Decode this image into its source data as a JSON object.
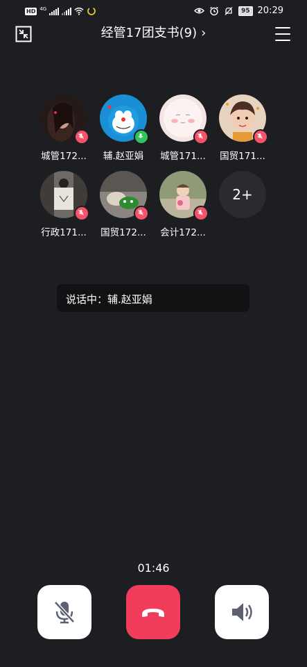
{
  "status_bar": {
    "hd_label": "HD",
    "network_label": "4G",
    "battery_level": "95",
    "time": "20:29"
  },
  "header": {
    "title": "经管17团支书(9)",
    "chevron": "›"
  },
  "members": [
    {
      "name": "城管172...",
      "mic": "muted"
    },
    {
      "name": "辅.赵亚娟",
      "mic": "active"
    },
    {
      "name": "城管171...",
      "mic": "muted"
    },
    {
      "name": "国贸171...",
      "mic": "muted"
    },
    {
      "name": "行政171...",
      "mic": "muted"
    },
    {
      "name": "国贸172...",
      "mic": "muted"
    },
    {
      "name": "会计172...",
      "mic": "muted"
    }
  ],
  "more_members": "2+",
  "speaking": {
    "text": "说话中：辅.赵亚娟"
  },
  "call": {
    "duration": "01:46"
  },
  "colors": {
    "background": "#1d1e22",
    "hangup": "#f23c5c",
    "mic_muted": "#f5536a",
    "mic_active": "#31c35d"
  },
  "icons": [
    "minimize-icon",
    "menu-icon",
    "mic-off-icon",
    "phone-hangup-icon",
    "speaker-icon"
  ]
}
